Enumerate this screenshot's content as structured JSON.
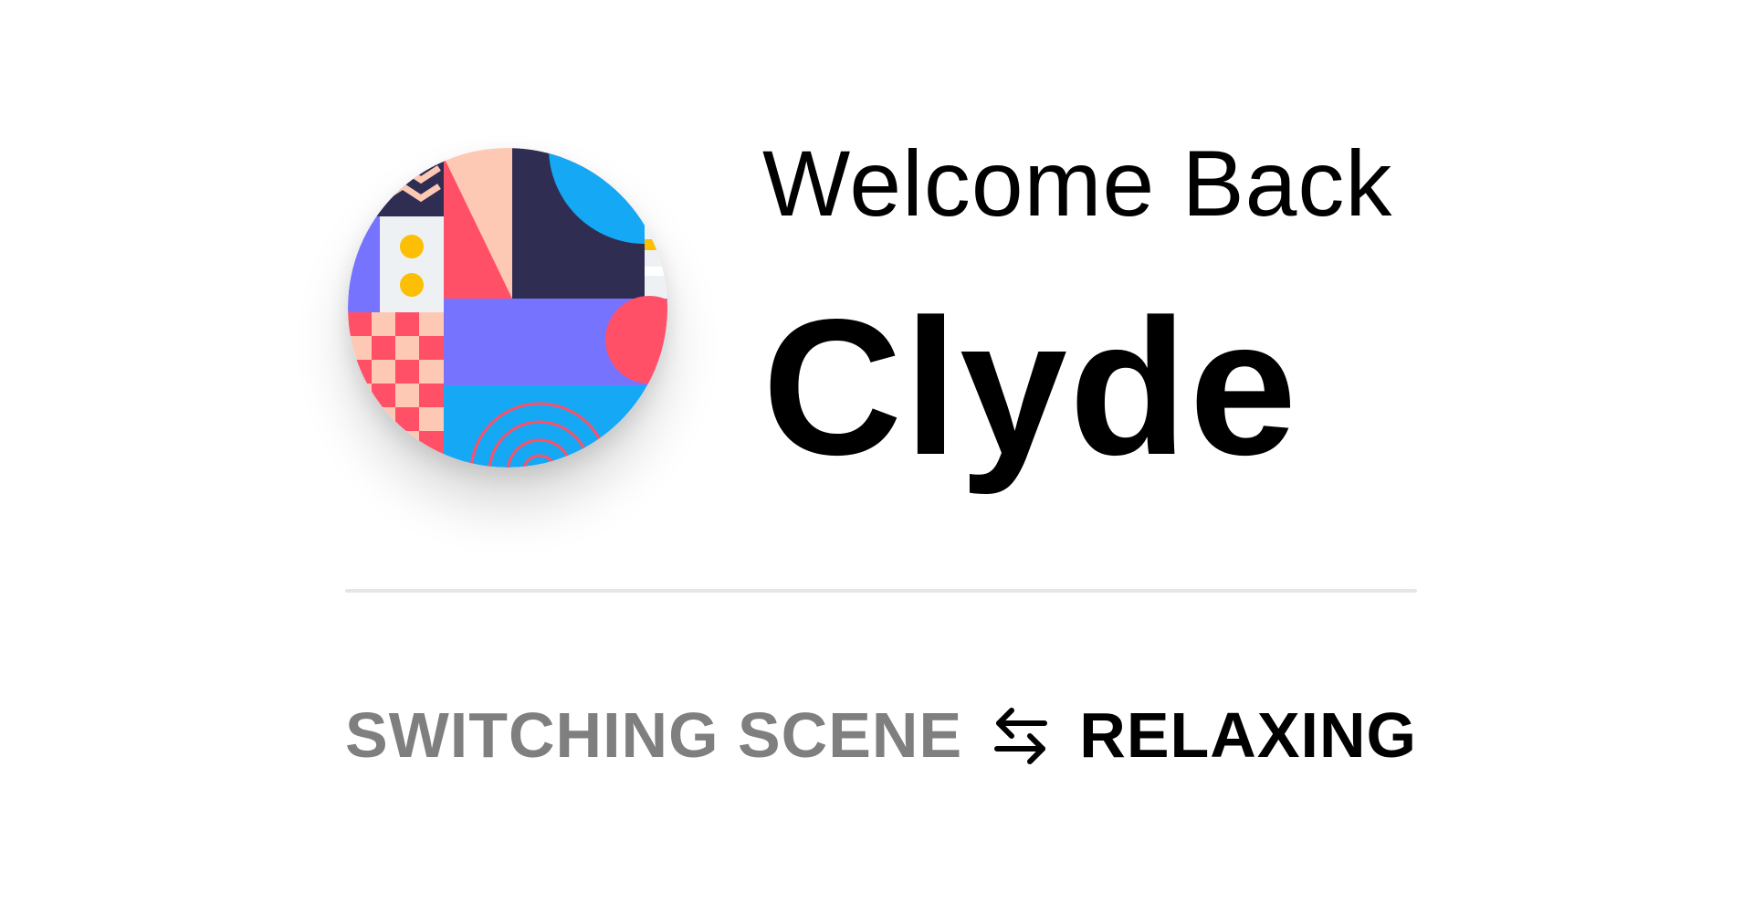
{
  "greeting": {
    "welcome_text": "Welcome Back",
    "username": "Clyde"
  },
  "avatar": {
    "icon": "abstract-pattern-avatar",
    "colors": {
      "navy": "#302d52",
      "peach": "#fdc8b4",
      "coral": "#ff5067",
      "sky": "#15a8f4",
      "violet": "#7673ff",
      "yellow": "#fcbf06",
      "light": "#eef1f4"
    }
  },
  "status": {
    "label": "SWITCHING SCENE",
    "icon": "swap-arrows-icon",
    "value": "RELAXING"
  },
  "colors": {
    "background": "#ffffff",
    "label_gray": "#7f7f7f",
    "text_black": "#000000",
    "divider": "#e6e6e6"
  }
}
